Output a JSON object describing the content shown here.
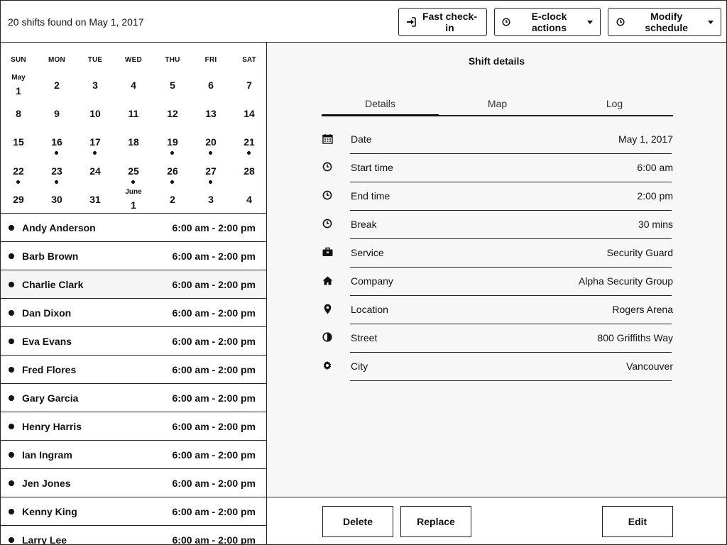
{
  "header": {
    "title": "20 shifts found on May 1, 2017",
    "fast_checkin": "Fast check-in",
    "eclock_actions": "E-clock actions",
    "modify_schedule": "Modify schedule"
  },
  "calendar": {
    "days_of_week": [
      "SUN",
      "MON",
      "TUE",
      "WED",
      "THU",
      "FRI",
      "SAT"
    ],
    "weeks": [
      [
        {
          "label": "May",
          "day": "1",
          "dot": false
        },
        {
          "day": "2",
          "dot": false
        },
        {
          "day": "3",
          "dot": false
        },
        {
          "day": "4",
          "dot": false
        },
        {
          "day": "5",
          "dot": false
        },
        {
          "day": "6",
          "dot": false
        },
        {
          "day": "7",
          "dot": false
        }
      ],
      [
        {
          "day": "8",
          "dot": false
        },
        {
          "day": "9",
          "dot": false
        },
        {
          "day": "10",
          "dot": false
        },
        {
          "day": "11",
          "dot": false
        },
        {
          "day": "12",
          "dot": false
        },
        {
          "day": "13",
          "dot": false
        },
        {
          "day": "14",
          "dot": false
        }
      ],
      [
        {
          "day": "15",
          "dot": false
        },
        {
          "day": "16",
          "dot": true
        },
        {
          "day": "17",
          "dot": true
        },
        {
          "day": "18",
          "dot": false
        },
        {
          "day": "19",
          "dot": true
        },
        {
          "day": "20",
          "dot": true
        },
        {
          "day": "21",
          "dot": true
        }
      ],
      [
        {
          "day": "22",
          "dot": true
        },
        {
          "day": "23",
          "dot": true
        },
        {
          "day": "24",
          "dot": false
        },
        {
          "day": "25",
          "dot": true
        },
        {
          "day": "26",
          "dot": true
        },
        {
          "day": "27",
          "dot": true
        },
        {
          "day": "28",
          "dot": false
        }
      ],
      [
        {
          "day": "29",
          "dot": false
        },
        {
          "day": "30",
          "dot": false
        },
        {
          "day": "31",
          "dot": false
        },
        {
          "label": "June",
          "day": "1",
          "dot": false
        },
        {
          "day": "2",
          "dot": false
        },
        {
          "day": "3",
          "dot": false
        },
        {
          "day": "4",
          "dot": false
        }
      ]
    ]
  },
  "shifts": [
    {
      "name": "Andy Anderson",
      "time": "6:00 am - 2:00 pm",
      "selected": false
    },
    {
      "name": "Barb Brown",
      "time": "6:00 am - 2:00 pm",
      "selected": false
    },
    {
      "name": "Charlie Clark",
      "time": "6:00 am - 2:00 pm",
      "selected": true
    },
    {
      "name": "Dan Dixon",
      "time": "6:00 am - 2:00 pm",
      "selected": false
    },
    {
      "name": "Eva Evans",
      "time": "6:00 am - 2:00 pm",
      "selected": false
    },
    {
      "name": "Fred Flores",
      "time": "6:00 am - 2:00 pm",
      "selected": false
    },
    {
      "name": "Gary Garcia",
      "time": "6:00 am - 2:00 pm",
      "selected": false
    },
    {
      "name": "Henry Harris",
      "time": "6:00 am - 2:00 pm",
      "selected": false
    },
    {
      "name": "Ian Ingram",
      "time": "6:00 am - 2:00 pm",
      "selected": false
    },
    {
      "name": "Jen Jones",
      "time": "6:00 am - 2:00 pm",
      "selected": false
    },
    {
      "name": "Kenny King",
      "time": "6:00 am - 2:00 pm",
      "selected": false
    },
    {
      "name": "Larry Lee",
      "time": "6:00 am - 2:00 pm",
      "selected": false
    }
  ],
  "details": {
    "title": "Shift details",
    "tabs": [
      {
        "label": "Details",
        "active": true
      },
      {
        "label": "Map",
        "active": false
      },
      {
        "label": "Log",
        "active": false
      }
    ],
    "rows": [
      {
        "icon": "calendar-icon",
        "label": "Date",
        "value": "May 1, 2017"
      },
      {
        "icon": "clock-icon",
        "label": "Start time",
        "value": "6:00 am"
      },
      {
        "icon": "clock-icon",
        "label": "End time",
        "value": "2:00 pm"
      },
      {
        "icon": "clock-icon",
        "label": "Break",
        "value": "30 mins"
      },
      {
        "icon": "briefcase-icon",
        "label": "Service",
        "value": "Security Guard"
      },
      {
        "icon": "home-icon",
        "label": "Company",
        "value": "Alpha Security Group"
      },
      {
        "icon": "map-pin-icon",
        "label": "Location",
        "value": "Rogers Arena"
      },
      {
        "icon": "adjust-icon",
        "label": "Street",
        "value": "800 Griffiths Way"
      },
      {
        "icon": "gear-icon",
        "label": "City",
        "value": "Vancouver"
      }
    ]
  },
  "footer": {
    "delete": "Delete",
    "replace": "Replace",
    "edit": "Edit"
  }
}
